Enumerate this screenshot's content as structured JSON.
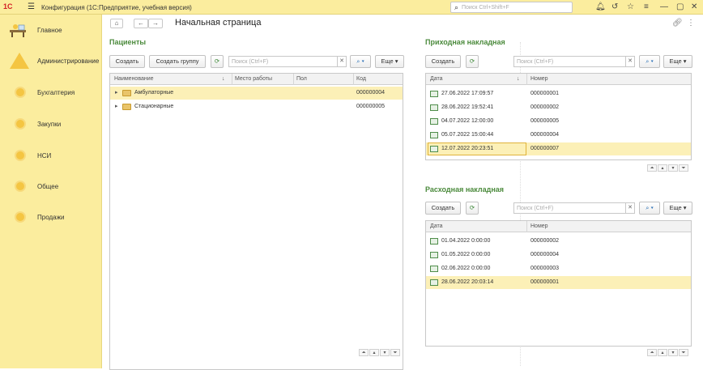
{
  "app": {
    "logo": "1С",
    "title": "Конфигурация  (1С:Предприятие, учебная версия)",
    "search_placeholder": "Поиск Ctrl+Shift+F"
  },
  "sidebar": {
    "items": [
      {
        "label": "Главное"
      },
      {
        "label": "Администрирование"
      },
      {
        "label": "Бухгалтерия"
      },
      {
        "label": "Закупки"
      },
      {
        "label": "НСИ"
      },
      {
        "label": "Общее"
      },
      {
        "label": "Продажи"
      }
    ]
  },
  "page": {
    "title": "Начальная страница"
  },
  "patients": {
    "title": "Пациенты",
    "create_label": "Создать",
    "create_group_label": "Создать группу",
    "search_placeholder": "Поиск (Ctrl+F)",
    "more_label": "Еще",
    "columns": [
      "Наименование",
      "Место работы",
      "Пол",
      "Код"
    ],
    "rows": [
      {
        "name": "Амбулаторные",
        "code": "000000004",
        "selected": true
      },
      {
        "name": "Стационарные",
        "code": "000000005",
        "selected": false
      }
    ]
  },
  "incoming": {
    "title": "Приходная накладная",
    "create_label": "Создать",
    "search_placeholder": "Поиск (Ctrl+F)",
    "more_label": "Еще",
    "columns": [
      "Дата",
      "Номер"
    ],
    "rows": [
      {
        "date": "27.06.2022 17:09:57",
        "number": "000000001"
      },
      {
        "date": "28.06.2022 19:52:41",
        "number": "000000002"
      },
      {
        "date": "04.07.2022 12:00:00",
        "number": "000000005"
      },
      {
        "date": "05.07.2022 15:00:44",
        "number": "000000004"
      },
      {
        "date": "12.07.2022 20:23:51",
        "number": "000000007"
      }
    ]
  },
  "outgoing": {
    "title": "Расходная накладная",
    "create_label": "Создать",
    "search_placeholder": "Поиск (Ctrl+F)",
    "more_label": "Еще",
    "columns": [
      "Дата",
      "Номер"
    ],
    "rows": [
      {
        "date": "01.04.2022 0:00:00",
        "number": "000000002"
      },
      {
        "date": "01.05.2022 0:00:00",
        "number": "000000004"
      },
      {
        "date": "02.06.2022 0:00:00",
        "number": "000000003"
      },
      {
        "date": "28.06.2022 20:03:14",
        "number": "000000001"
      }
    ]
  },
  "colors": {
    "accent_yellow": "#fbed9e",
    "section_green": "#4b8a3c",
    "selection": "#fcf0b7"
  }
}
